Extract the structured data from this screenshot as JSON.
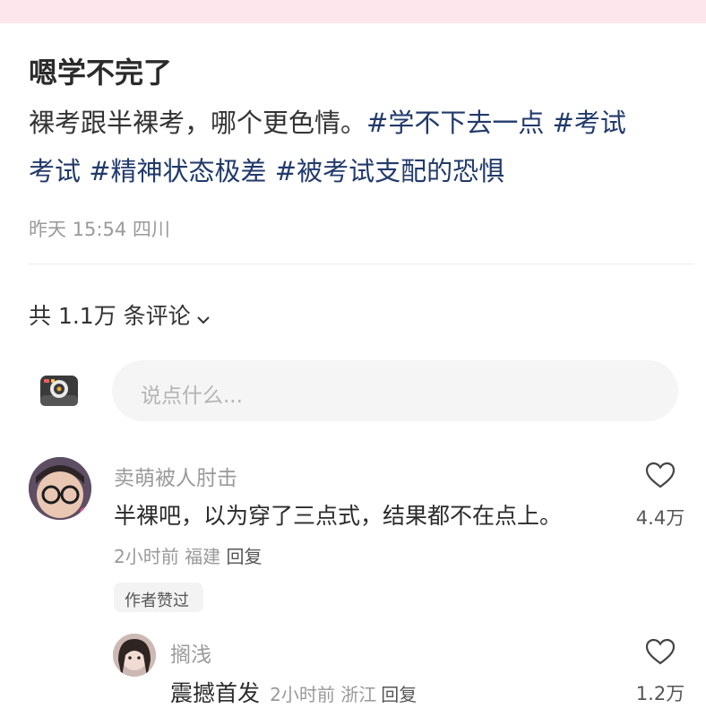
{
  "post": {
    "title": "嗯学不完了",
    "body_text": "裸考跟半裸考，哪个更色情。",
    "tags": [
      "#学不下去一点",
      "#考试考试",
      "#精神状态极差",
      "#被考试支配的恐惧"
    ],
    "tag_line1_a": "#学不下去一点",
    "tag_line1_b": "#考试",
    "tag_line2_a": "考试",
    "tag_line2_b": "#精神状态极差",
    "tag_line2_c": "#被考试支配的恐惧",
    "meta": "昨天 15:54 四川"
  },
  "comments_header": {
    "count_label": "共 1.1万 条评论"
  },
  "comment_input": {
    "placeholder": "说点什么..."
  },
  "comments": [
    {
      "user": "卖萌被人肘击",
      "text": "半裸吧，以为穿了三点式，结果都不在点上。",
      "meta": "2小时前 福建",
      "reply": "回复",
      "badge": "作者赞过",
      "likes": "4.4万"
    },
    {
      "user": "搁浅",
      "text": "震撼首发",
      "meta": "2小时前 浙江",
      "reply": "回复",
      "likes": "1.2万"
    }
  ],
  "colors": {
    "topbar": "#fde7ec",
    "tag": "#223a6b",
    "muted": "#9a9a9a"
  },
  "icons": [
    "camera-icon",
    "chevron-down-icon",
    "heart-icon"
  ]
}
